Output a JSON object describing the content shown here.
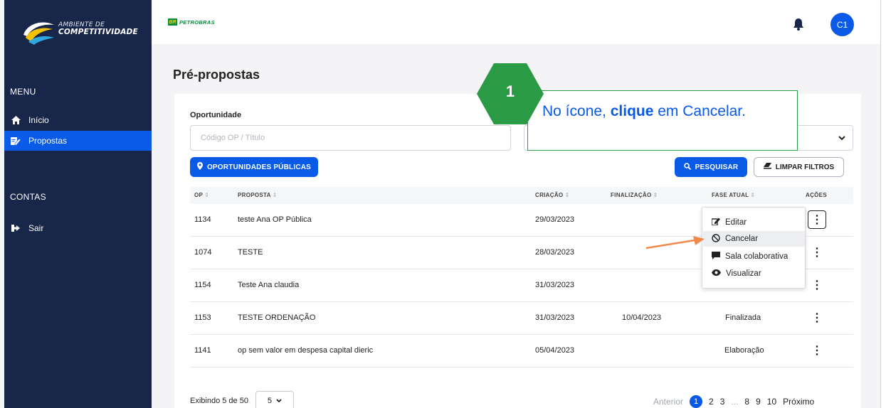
{
  "app": {
    "logo_line1": "AMBIENTE DE",
    "logo_line2": "COMPETITIVIDADE",
    "brand_badge": "BR",
    "brand_name": "PETROBRAS",
    "avatar_initials": "C1"
  },
  "sidebar": {
    "menu_heading": "MENU",
    "accounts_heading": "CONTAS",
    "items": [
      {
        "label": "Início",
        "icon": "home-icon"
      },
      {
        "label": "Propostas",
        "icon": "edit-document-icon",
        "active": true
      }
    ],
    "account_items": [
      {
        "label": "Sair",
        "icon": "sign-out-icon"
      }
    ]
  },
  "page": {
    "title": "Pré-propostas"
  },
  "filters": {
    "field_label": "Oportunidade",
    "search_placeholder": "Código OP / Título",
    "public_button": "OPORTUNIDADES PÚBLICAS",
    "search_button": "PESQUISAR",
    "clear_button": "LIMPAR FILTROS"
  },
  "table": {
    "columns": [
      "OP",
      "PROPOSTA",
      "CRIAÇÃO",
      "FINALIZAÇÃO",
      "FASE ATUAL",
      "AÇÕES"
    ],
    "rows": [
      {
        "op": "1134",
        "proposta": "teste Ana OP Pública",
        "criacao": "29/03/2023",
        "finalizacao": "",
        "fase": ""
      },
      {
        "op": "1074",
        "proposta": "TESTE",
        "criacao": "28/03/2023",
        "finalizacao": "",
        "fase": ""
      },
      {
        "op": "1154",
        "proposta": "Teste Ana claudia",
        "criacao": "31/03/2023",
        "finalizacao": "",
        "fase": ""
      },
      {
        "op": "1153",
        "proposta": "TESTE ORDENAÇÃO",
        "criacao": "31/03/2023",
        "finalizacao": "10/04/2023",
        "fase": "Finalizada"
      },
      {
        "op": "1141",
        "proposta": "op sem valor em despesa capital dieric",
        "criacao": "05/04/2023",
        "finalizacao": "",
        "fase": "Elaboração"
      }
    ]
  },
  "actions_menu": {
    "items": [
      {
        "label": "Editar",
        "icon": "edit-icon"
      },
      {
        "label": "Cancelar",
        "icon": "cancel-circle-icon",
        "highlighted": true
      },
      {
        "label": "Sala colaborativa",
        "icon": "chat-icon"
      },
      {
        "label": "Visualizar",
        "icon": "eye-icon"
      }
    ]
  },
  "pagination": {
    "showing_text": "Exibindo 5 de 50",
    "per_page": "5",
    "prev": "Anterior",
    "pages": [
      "1",
      "2",
      "3",
      "...",
      "8",
      "9",
      "10"
    ],
    "current": "1",
    "next": "Próximo"
  },
  "callout": {
    "step": "1",
    "text_before": "No ícone, ",
    "text_bold": "clique",
    "text_after": " em Cancelar."
  },
  "colors": {
    "sidebar": "#18264a",
    "accent": "#0a5ae8",
    "callout_green": "#2b9a44",
    "arrow": "#f0894a"
  }
}
